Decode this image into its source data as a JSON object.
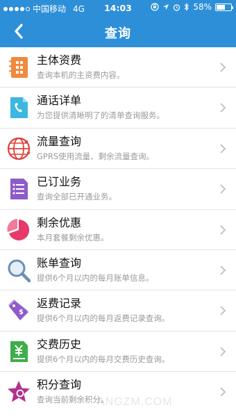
{
  "status_bar": {
    "carrier": "中国移动",
    "network": "4G",
    "time": "14:03",
    "battery": "58%"
  },
  "nav": {
    "title": "查询",
    "back_icon": "chevron-left-icon"
  },
  "items": [
    {
      "title": "主体资费",
      "subtitle": "查询本机的主资费内容。",
      "icon": "notebook-icon",
      "color": "#f08a3c"
    },
    {
      "title": "通话详单",
      "subtitle": "为您提供清晰明了的清单查询服务。",
      "icon": "phone-document-icon",
      "color": "#3db6e2"
    },
    {
      "title": "流量查询",
      "subtitle": "GPRS使用流量、剩余流量查询。",
      "icon": "globe-icon",
      "color": "#e0403a"
    },
    {
      "title": "已订业务",
      "subtitle": "查询全部已开通业务。",
      "icon": "list-document-icon",
      "color": "#8e5bc8"
    },
    {
      "title": "剩余优惠",
      "subtitle": "本月套餐剩余优惠。",
      "icon": "pie-chart-icon",
      "color": "#e83a6a"
    },
    {
      "title": "账单查询",
      "subtitle": "提供6个月以内的每月账单信息。",
      "icon": "magnifier-icon",
      "color": "#6a8fb8"
    },
    {
      "title": "返费记录",
      "subtitle": "提供6个月以内的每月返费记录查询。",
      "icon": "price-tag-icon",
      "color": "#8e5bc8"
    },
    {
      "title": "交费历史",
      "subtitle": "提供6个月以内的每月交费历史查询。",
      "icon": "yuan-receipt-icon",
      "color": "#3fae4a"
    },
    {
      "title": "积分查询",
      "subtitle": "查询当前剩余积分。",
      "icon": "star-icon",
      "color": "#b2308e"
    }
  ],
  "watermark": "ANGZM.COM"
}
